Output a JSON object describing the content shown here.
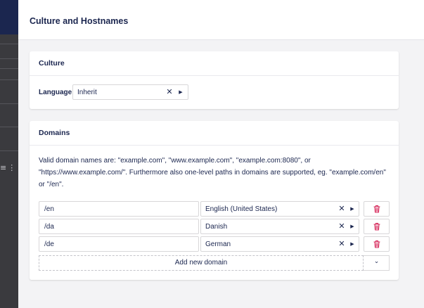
{
  "panel": {
    "title": "Culture and Hostnames"
  },
  "culture": {
    "heading": "Culture",
    "language_label": "Language",
    "language_value": "Inherit"
  },
  "domains": {
    "heading": "Domains",
    "description": "Valid domain names are: \"example.com\", \"www.example.com\", \"example.com:8080\", or \"https://www.example.com/\". Furthermore also one-level paths in domains are supported, eg. \"example.com/en\" or \"/en\".",
    "rows": [
      {
        "domain": "/en",
        "language": "English (United States)"
      },
      {
        "domain": "/da",
        "language": "Danish"
      },
      {
        "domain": "/de",
        "language": "German"
      }
    ],
    "add_label": "Add new domain"
  },
  "icons": {
    "clear": "close-icon",
    "expand": "caret-right-icon",
    "delete": "trash-icon",
    "dropdown": "chevron-down-icon"
  },
  "colors": {
    "primary_text": "#1b264f",
    "danger": "#d42054",
    "background": "#f3f3f5"
  }
}
